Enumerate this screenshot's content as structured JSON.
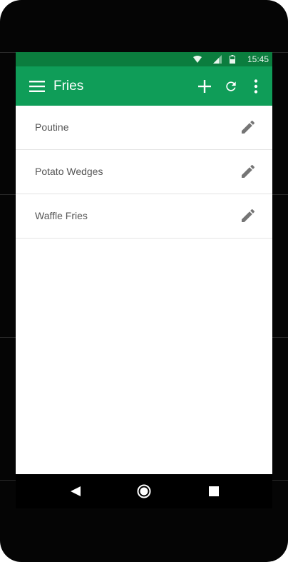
{
  "status_bar": {
    "time": "15:45",
    "icons": [
      "wifi-icon",
      "signal-icon",
      "battery-icon"
    ]
  },
  "app_bar": {
    "title": "Fries",
    "menu_icon": "menu-icon",
    "actions": [
      "add-icon",
      "refresh-icon",
      "more-vert-icon"
    ]
  },
  "list": {
    "items": [
      {
        "label": "Poutine",
        "action_icon": "edit-icon"
      },
      {
        "label": "Potato Wedges",
        "action_icon": "edit-icon"
      },
      {
        "label": "Waffle Fries",
        "action_icon": "edit-icon"
      }
    ]
  },
  "nav_bar": {
    "buttons": [
      "back-icon",
      "home-icon",
      "recents-icon"
    ]
  },
  "colors": {
    "primary": "#0f9d58",
    "primary_dark": "#0b7d3e",
    "text": "#555555",
    "icon": "#757575"
  }
}
